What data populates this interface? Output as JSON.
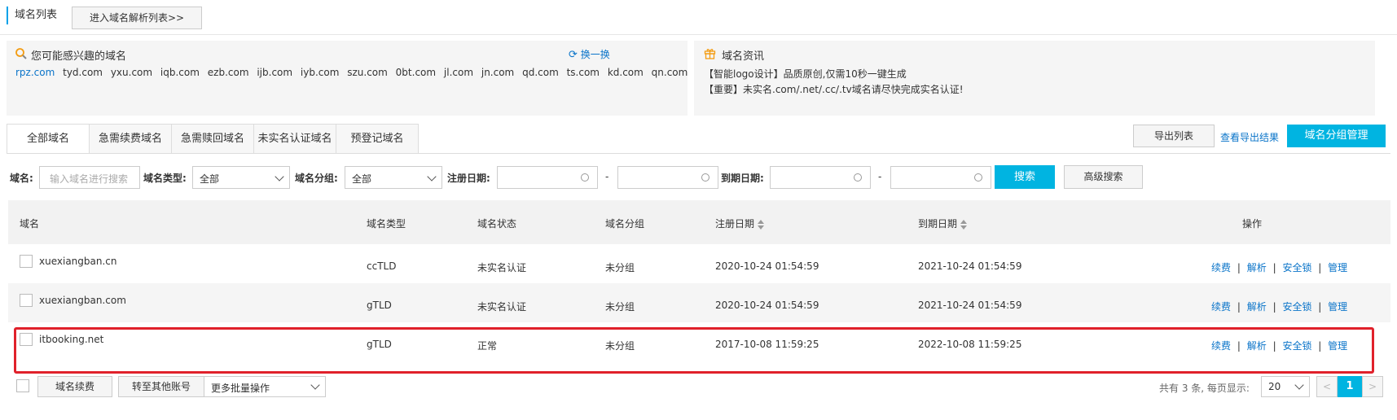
{
  "header": {
    "title": "域名列表",
    "goto_label": "进入域名解析列表>>"
  },
  "interest": {
    "title": "您可能感兴趣的域名",
    "refresh_label": "换一换",
    "domains": [
      "rpz.com",
      "tyd.com",
      "yxu.com",
      "iqb.com",
      "ezb.com",
      "ijb.com",
      "iyb.com",
      "szu.com",
      "0bt.com",
      "jl.com",
      "jn.com",
      "qd.com",
      "ts.com",
      "kd.com",
      "qn.com"
    ]
  },
  "news": {
    "title": "域名资讯",
    "items": [
      "【智能logo设计】品质原创,仅需10秒一键生成",
      "【重要】未实名.com/.net/.cc/.tv域名请尽快完成实名认证!"
    ]
  },
  "tabs": [
    "全部域名",
    "急需续费域名",
    "急需赎回域名",
    "未实名认证域名",
    "预登记域名"
  ],
  "toolbar": {
    "export_label": "导出列表",
    "export_result_label": "查看导出结果",
    "group_manage_label": "域名分组管理"
  },
  "filters": {
    "domain_label": "域名:",
    "domain_placeholder": "输入域名进行搜索",
    "type_label": "域名类型:",
    "type_value": "全部",
    "group_label": "域名分组:",
    "group_value": "全部",
    "reg_label": "注册日期:",
    "exp_label": "到期日期:",
    "dash": "-",
    "search_label": "搜索",
    "advanced_label": "高级搜索"
  },
  "table": {
    "headers": {
      "domain": "域名",
      "type": "域名类型",
      "status": "域名状态",
      "group": "域名分组",
      "reg": "注册日期",
      "exp": "到期日期",
      "ops": "操作"
    },
    "rows": [
      {
        "domain": "xuexiangban.cn",
        "type": "ccTLD",
        "status": "未实名认证",
        "group": "未分组",
        "reg": "2020-10-24 01:54:59",
        "exp": "2021-10-24 01:54:59"
      },
      {
        "domain": "xuexiangban.com",
        "type": "gTLD",
        "status": "未实名认证",
        "group": "未分组",
        "reg": "2020-10-24 01:54:59",
        "exp": "2021-10-24 01:54:59"
      },
      {
        "domain": "itbooking.net",
        "type": "gTLD",
        "status": "正常",
        "group": "未分组",
        "reg": "2017-10-08 11:59:25",
        "exp": "2022-10-08 11:59:25"
      }
    ],
    "ops": {
      "renew": "续费",
      "resolve": "解析",
      "lock": "安全锁",
      "manage": "管理",
      "sep": "|"
    }
  },
  "footer": {
    "renew_label": "域名续费",
    "transfer_label": "转至其他账号",
    "batch_label": "更多批量操作",
    "total_text": "共有 3 条, 每页显示:",
    "page_size": "20",
    "current_page": "1",
    "prev": "<",
    "next": ">"
  },
  "colors": {
    "accent": "#00b4e1",
    "link": "#0a74c9",
    "highlight": "#e0212b"
  }
}
